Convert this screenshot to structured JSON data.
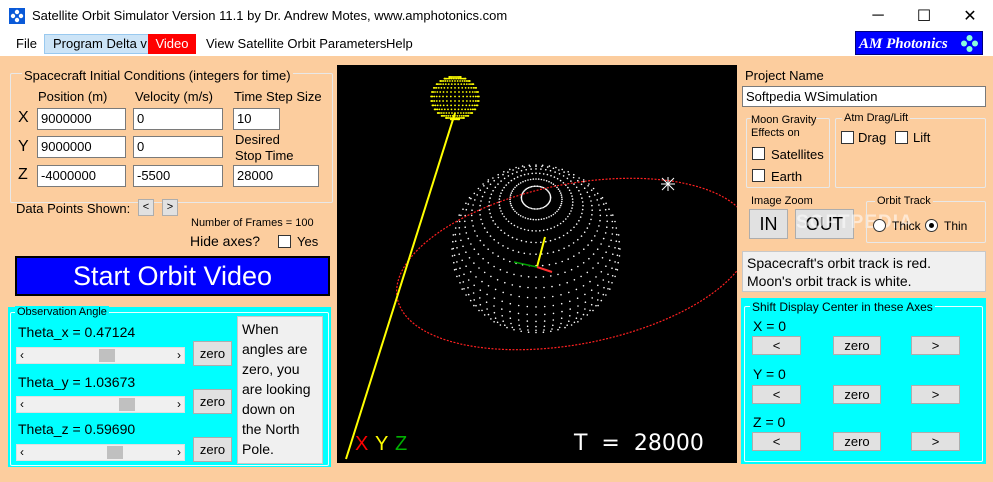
{
  "window": {
    "title": "Satellite Orbit Simulator Version 11.1 by Dr. Andrew Motes, www.amphotonics.com",
    "minimize": "─",
    "maximize": "☐",
    "close": "✕"
  },
  "menu": {
    "file": "File",
    "program_delta": "Program Delta v",
    "video": "Video",
    "view_params": "View Satellite Orbit Parameters",
    "help": "Help",
    "brand": "AM Photonics"
  },
  "initial_conditions": {
    "title": "Spacecraft Initial Conditions (integers for time)",
    "position_header": "Position (m)",
    "velocity_header": "Velocity (m/s)",
    "timestep_header": "Time Step Size",
    "x_label": "X",
    "y_label": "Y",
    "z_label": "Z",
    "pos_x": "9000000",
    "pos_y": "9000000",
    "pos_z": "-4000000",
    "vel_x": "0",
    "vel_y": "0",
    "vel_z": "-5500",
    "timestep": "10",
    "desired_label_1": "Desired",
    "desired_label_2": "Stop Time",
    "stop_time": "28000"
  },
  "data_points": {
    "label": "Data Points Shown:",
    "prev": "<",
    "next": ">",
    "frames": "Number of Frames = 100",
    "hide_axes": "Hide axes?",
    "yes": "Yes"
  },
  "start_button": "Start Orbit Video",
  "observation": {
    "title": "Observation Angle",
    "theta_x": "Theta_x = 0.47124",
    "theta_y": "Theta_y = 1.03673",
    "theta_z": "Theta_z = 0.59690",
    "theta_x_level": 0.55,
    "theta_y_level": 0.72,
    "theta_z_level": 0.62,
    "zero": "zero",
    "note": "When angles are zero, you are looking down on the North Pole.",
    "arrow_left": "‹",
    "arrow_right": "›"
  },
  "canvas": {
    "axis_x": "X",
    "axis_y": "Y",
    "axis_z": "Z",
    "time": "T  =  28000",
    "watermark": "SOFTPEDIA",
    "colors": {
      "orbit": "#ff2020",
      "moon": "#ffff00",
      "earth": "#ffffff"
    }
  },
  "project": {
    "label": "Project Name",
    "value": "Softpedia WSimulation"
  },
  "moon_gravity": {
    "title_1": "Moon Gravity",
    "title_2": "Effects on",
    "satellites": "Satellites",
    "earth": "Earth"
  },
  "atm": {
    "title": "Atm Drag/Lift",
    "drag": "Drag",
    "lift": "Lift"
  },
  "zoom": {
    "title": "Image Zoom",
    "in": "IN",
    "out": "OUT"
  },
  "orbit_track": {
    "title": "Orbit Track",
    "thick": "Thick",
    "thin": "Thin"
  },
  "info": {
    "line1": "Spacecraft's orbit track is red.",
    "line2": "Moon's orbit track is white."
  },
  "shift": {
    "title": "Shift Display Center in these Axes",
    "x": "X = 0",
    "y": "Y = 0",
    "z": "Z = 0",
    "left": "<",
    "zero": "zero",
    "right": ">"
  }
}
